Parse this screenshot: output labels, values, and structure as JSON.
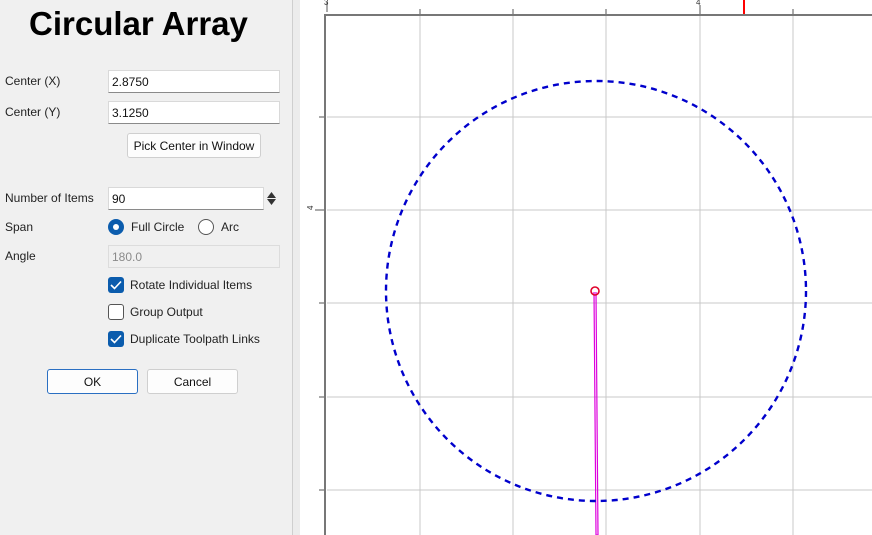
{
  "dialog": {
    "title": "Circular Array",
    "center_x": {
      "label": "Center (X)",
      "value": "2.8750"
    },
    "center_y": {
      "label": "Center (Y)",
      "value": "3.1250"
    },
    "pick_center_label": "Pick Center in Window",
    "num_items": {
      "label": "Number of Items",
      "value": "90"
    },
    "span": {
      "label": "Span",
      "options": [
        "Full Circle",
        "Arc"
      ],
      "selected": "Full Circle"
    },
    "angle": {
      "label": "Angle",
      "value": "180.0"
    },
    "rotate_items": {
      "label": "Rotate Individual Items",
      "checked": true
    },
    "group_output": {
      "label": "Group Output",
      "checked": false
    },
    "duplicate_links": {
      "label": "Duplicate Toolpath Links",
      "checked": true
    },
    "ok_label": "OK",
    "cancel_label": "Cancel"
  },
  "viewport": {
    "x_ruler_labels": [
      "3",
      "4"
    ],
    "y_ruler_labels": [
      "4"
    ],
    "colors": {
      "array_circle": "#0000cc",
      "center_marker": "#e0002a",
      "toolpath": "#dd00dd",
      "ruler_marker": "#ff0000",
      "grid": "#c8c8c8"
    }
  }
}
